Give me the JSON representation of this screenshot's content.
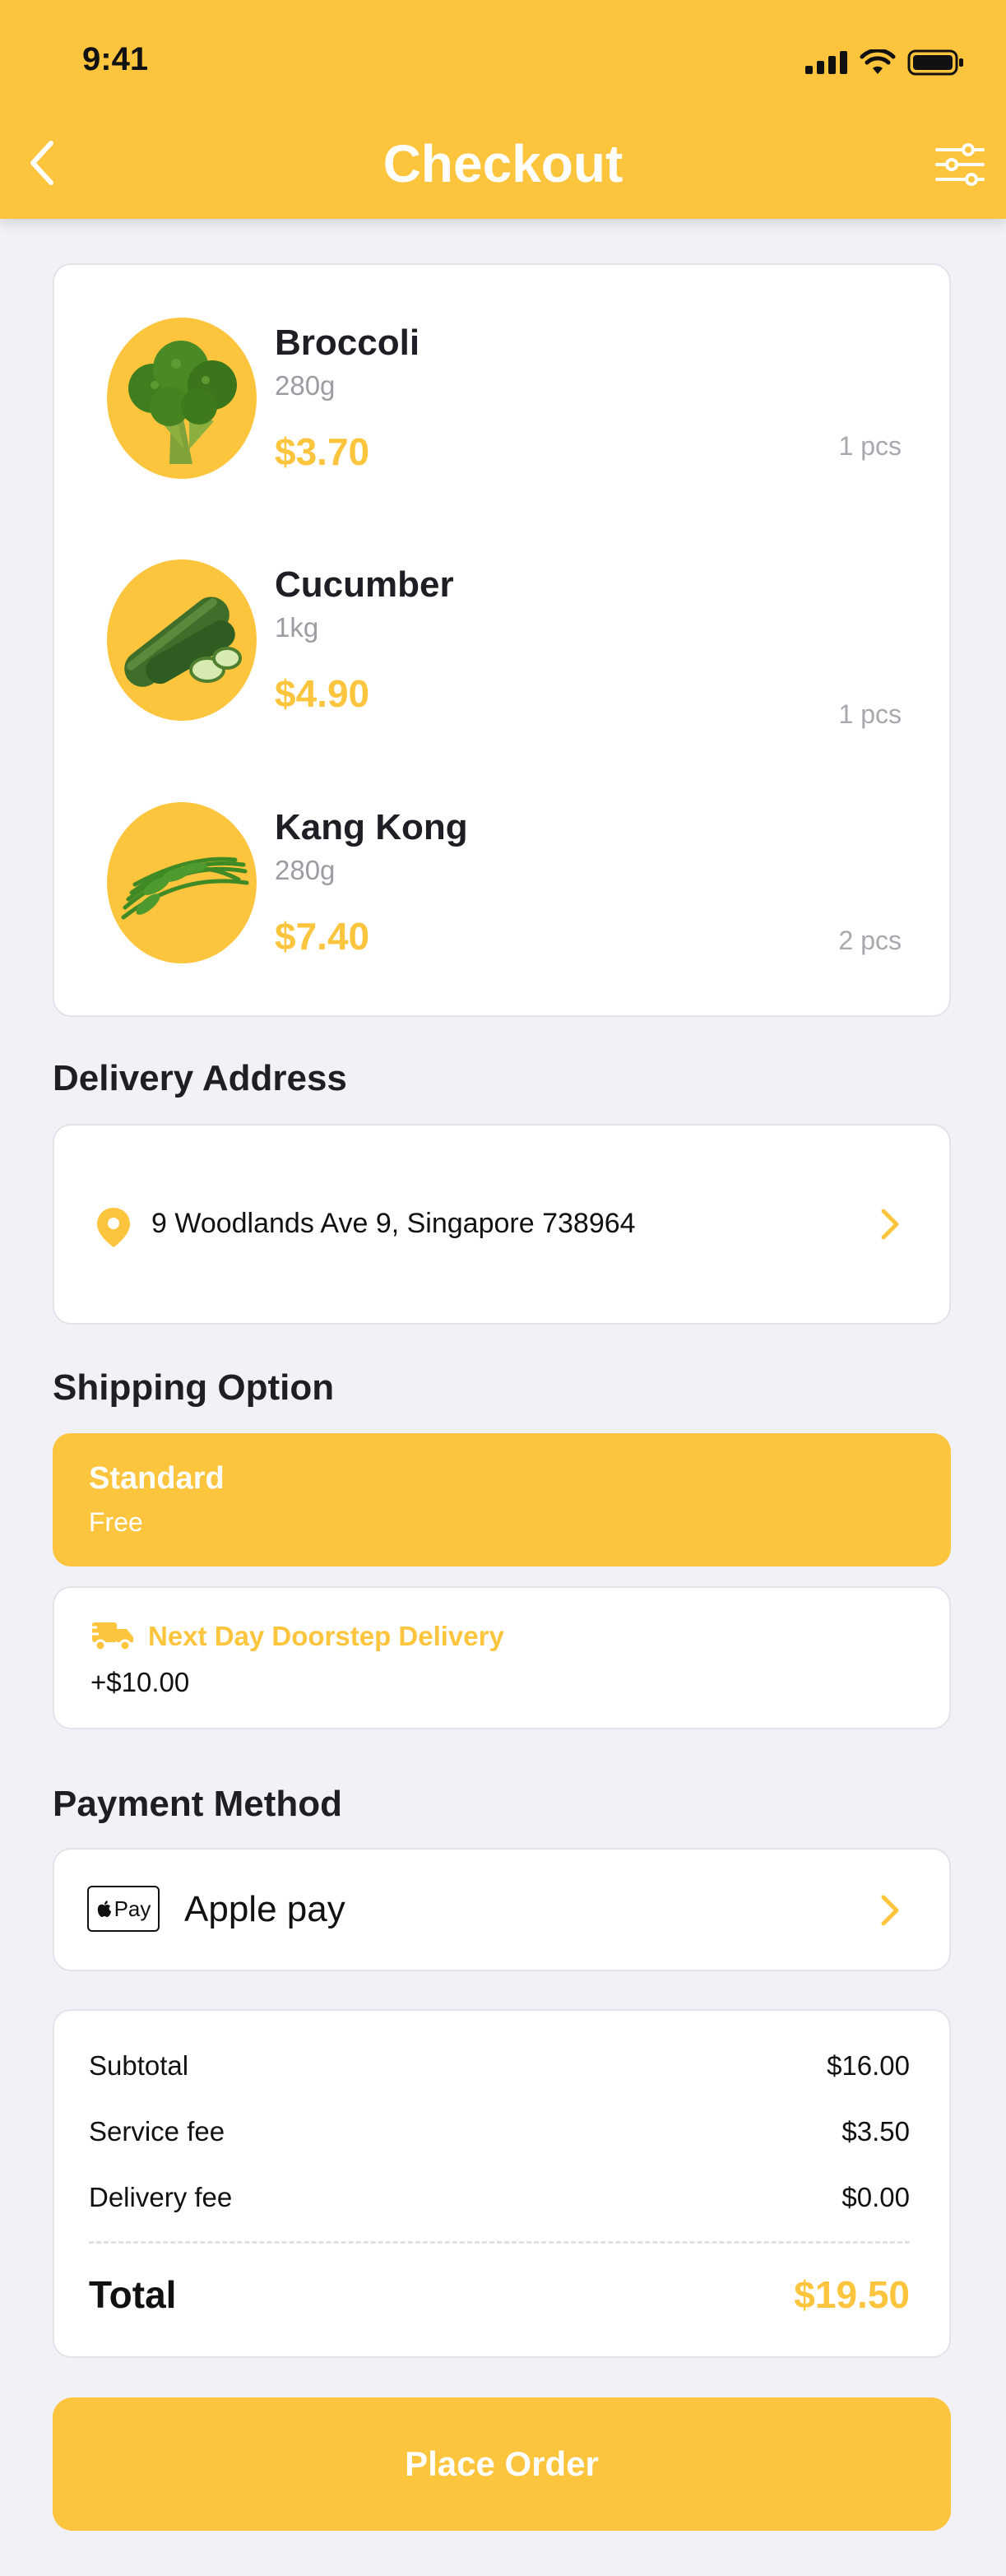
{
  "status_bar": {
    "time": "9:41"
  },
  "header": {
    "title": "Checkout"
  },
  "products": [
    {
      "name": "Broccoli",
      "weight": "280g",
      "price": "$3.70",
      "qty": "1 pcs"
    },
    {
      "name": "Cucumber",
      "weight": "1kg",
      "price": "$4.90",
      "qty": "1 pcs"
    },
    {
      "name": "Kang Kong",
      "weight": "280g",
      "price": "$7.40",
      "qty": "2 pcs"
    }
  ],
  "delivery": {
    "title": "Delivery Address",
    "address": "9 Woodlands Ave 9, Singapore 738964"
  },
  "shipping": {
    "title": "Shipping Option",
    "options": [
      {
        "label": "Standard",
        "price": "Free",
        "selected": true
      },
      {
        "label": "Next Day Doorstep Delivery",
        "price": "+$10.00",
        "selected": false
      }
    ]
  },
  "payment": {
    "title": "Payment Method",
    "badge": "Pay",
    "method": "Apple pay"
  },
  "summary": {
    "rows": [
      {
        "label": "Subtotal",
        "value": "$16.00"
      },
      {
        "label": "Service fee",
        "value": "$3.50"
      },
      {
        "label": "Delivery fee",
        "value": "$0.00"
      }
    ],
    "total_label": "Total",
    "total_value": "$19.50"
  },
  "cta": {
    "label": "Place Order"
  },
  "colors": {
    "accent": "#fdc53d",
    "background": "#f1f1f7",
    "muted": "#9c9ca3"
  }
}
